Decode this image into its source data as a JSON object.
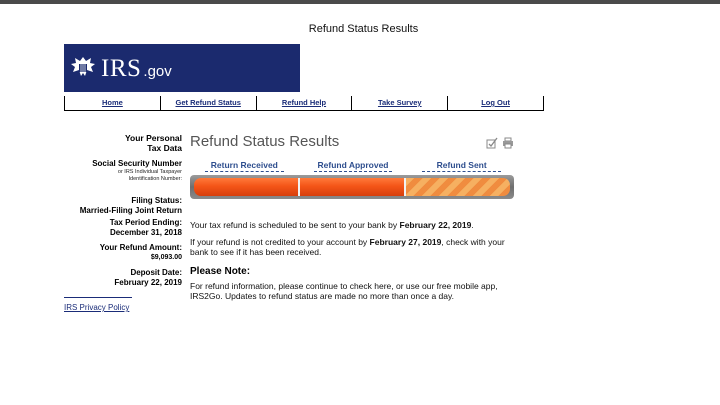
{
  "page_title": "Refund Status Results",
  "logo": {
    "irs_text": "IRS",
    "gov_text": ".gov"
  },
  "nav": [
    {
      "label": "Home"
    },
    {
      "label": "Get Refund Status"
    },
    {
      "label": "Refund Help"
    },
    {
      "label": "Take Survey"
    },
    {
      "label": "Log Out"
    }
  ],
  "sidebar": {
    "heading_line1": "Your Personal",
    "heading_line2": "Tax Data",
    "ssn_label": "Social Security Number",
    "ssn_sub1": "or IRS Individual Taxpayer",
    "ssn_sub2": "Identification Number:",
    "filing_label": "Filing Status:",
    "filing_value": "Married-Filing Joint Return",
    "period_label": "Tax Period Ending:",
    "period_value": "December 31, 2018",
    "refund_label": "Your Refund Amount:",
    "refund_value": "$9,093.00",
    "deposit_label": "Deposit Date:",
    "deposit_value": "February 22, 2019",
    "privacy_link": "IRS Privacy Policy"
  },
  "main": {
    "title": "Refund Status Results",
    "steps": [
      "Return Received",
      "Refund Approved",
      "Refund Sent"
    ],
    "progress": {
      "completed_steps": 2,
      "total_steps": 3
    },
    "p1_text": "Your tax refund is scheduled to be sent to your bank by ",
    "p1_date": "February 22, 2019",
    "p1_end": ".",
    "p2_text": "If your refund is not credited to your account by ",
    "p2_date": "February 27, 2019",
    "p2_end": ", check with your bank to see if it has been received.",
    "note_title": "Please Note:",
    "note_text": "For refund information, please continue to check here, or use our free mobile app, IRS2Go. Updates to refund status are made no more than once a day."
  },
  "colors": {
    "brand_navy": "#1b2a6e",
    "link_blue": "#1a2c78",
    "progress_orange": "#f45518"
  }
}
